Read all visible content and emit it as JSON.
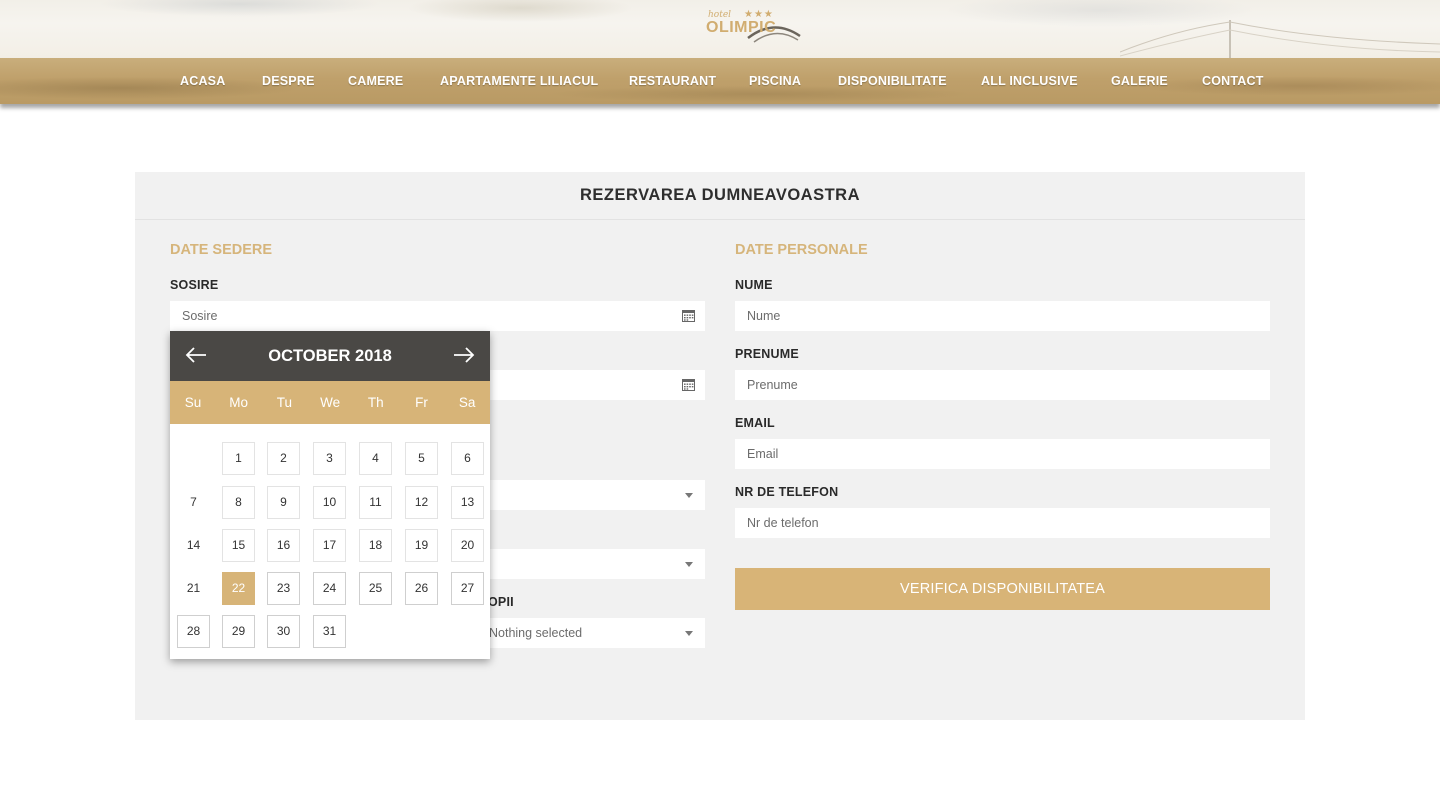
{
  "brand": {
    "logo_small": "hotel",
    "logo_text": "OLIMPIC",
    "stars": "★★★"
  },
  "nav": [
    "ACASA",
    "DESPRE",
    "CAMERE",
    "APARTAMENTE LILIACUL",
    "RESTAURANT",
    "PISCINA",
    "DISPONIBILITATE",
    "ALL INCLUSIVE",
    "GALERIE",
    "CONTACT"
  ],
  "form": {
    "title": "REZERVAREA DUMNEAVOASTRA",
    "stay_section": "DATE SEDERE",
    "personal_section": "DATE PERSONALE",
    "arrival_label": "SOSIRE",
    "arrival_placeholder": "Sosire",
    "children_label_fragment": "OPII",
    "children_select_value": "Nothing selected",
    "nume_label": "NUME",
    "nume_placeholder": "Nume",
    "prenume_label": "PRENUME",
    "prenume_placeholder": "Prenume",
    "email_label": "EMAIL",
    "email_placeholder": "Email",
    "phone_label": "NR DE TELEFON",
    "phone_placeholder": "Nr de telefon",
    "submit_label": "VERIFICA DISPONIBILITATEA"
  },
  "datepicker": {
    "month_title": "OCTOBER 2018",
    "day_names": [
      "Su",
      "Mo",
      "Tu",
      "We",
      "Th",
      "Fr",
      "Sa"
    ],
    "selected_day": "22",
    "weeks": [
      [
        "",
        "1",
        "2",
        "3",
        "4",
        "5",
        "6"
      ],
      [
        "7",
        "8",
        "9",
        "10",
        "11",
        "12",
        "13"
      ],
      [
        "14",
        "15",
        "16",
        "17",
        "18",
        "19",
        "20"
      ],
      [
        "21",
        "22",
        "23",
        "24",
        "25",
        "26",
        "27"
      ],
      [
        "28",
        "29",
        "30",
        "31",
        "",
        "",
        ""
      ]
    ]
  },
  "colors": {
    "accent": "#d8b477",
    "header_dark": "#4a4845",
    "panel": "#f1f1f1"
  }
}
